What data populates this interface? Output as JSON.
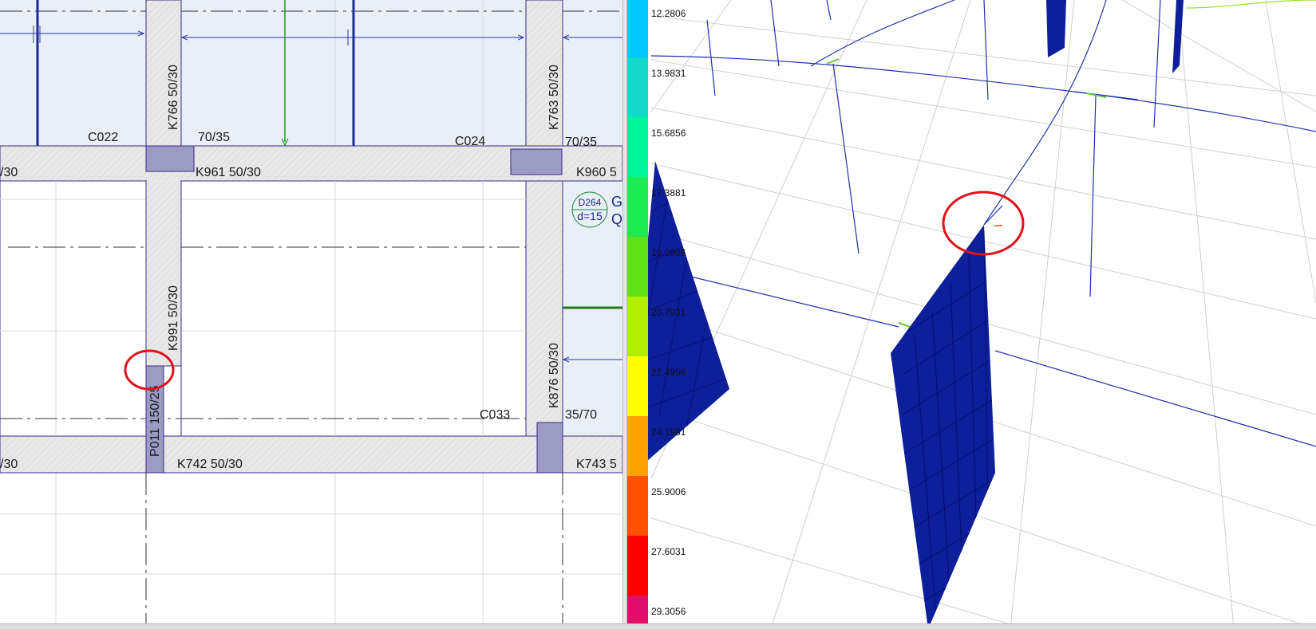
{
  "plan": {
    "labels": {
      "k766": "K766 50/30",
      "k763": "K763 50/30",
      "c022": "C022",
      "c024": "C024",
      "sz_70_35_a": "70/35",
      "sz_70_35_b": "70/35",
      "left_30_top": "/30",
      "k961": "K961 50/30",
      "k960": "K960 5",
      "k991": "K991 50/30",
      "p011": "P011 150/25",
      "k876": "K876 50/30",
      "c033": "C033",
      "sz_35_70": "35/70",
      "left_30_bottom": "/30",
      "k742": "K742 50/30",
      "k743": "K743 5",
      "slab_id": "D264",
      "slab_thk": "d=15",
      "edge_g": "G",
      "edge_q": "Q"
    },
    "colors": {
      "beam_fill": "#e6e6e6",
      "column_fill": "#9b9bc4",
      "outline": "#3c2a8c",
      "highlight": "#e0121b"
    }
  },
  "legend": {
    "ticks": [
      "12.2806",
      "13.9831",
      "15.6856",
      "17.3881",
      "19.0906",
      "20.7931",
      "22.4956",
      "24.1981",
      "25.9006",
      "27.6031",
      "29.3056"
    ],
    "colors": [
      "#00c8ff",
      "#14d7c8",
      "#00f59a",
      "#1eea52",
      "#62e01a",
      "#b2ee00",
      "#ffff00",
      "#ffa300",
      "#ff5200",
      "#ff0000",
      "#e0106a"
    ]
  }
}
